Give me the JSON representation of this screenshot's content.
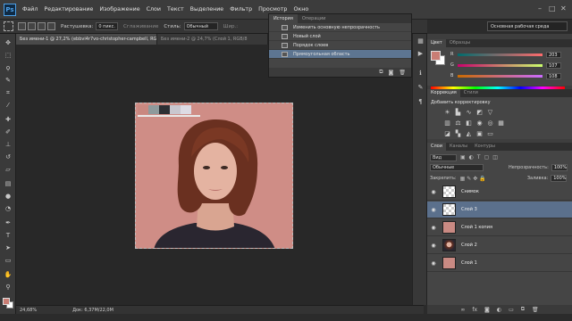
{
  "app": {
    "logo": "Ps"
  },
  "menu": [
    "Файл",
    "Редактирование",
    "Изображение",
    "Слои",
    "Текст",
    "Выделение",
    "Фильтр",
    "Просмотр",
    "Окно"
  ],
  "options": {
    "feather_label": "Растушевка:",
    "feather_value": "0 пикс.",
    "antialias_label": "Сглаживание",
    "style_label": "Стиль:",
    "style_value": "Обычный",
    "width_label": "Шир.:",
    "workspace": "Основная рабочая среда"
  },
  "doc_tabs": [
    {
      "label": "Без имени-1 @ 27,2% (ebbvi4r7vo-christopher-campbell, RGB/8",
      "active": true
    },
    {
      "label": "Без имени-2 @ 24,7% (Слой 1, RGB/8",
      "active": false
    }
  ],
  "palette_colors": [
    "#c98880",
    "#8e9a9c",
    "#2c2f34",
    "#c9c7cf",
    "#dddbe4"
  ],
  "status": {
    "zoom": "24,68%",
    "doc_size": "Док: 6,37М/22,0М"
  },
  "history": {
    "tabs": [
      "История",
      "Операции"
    ],
    "items": [
      {
        "label": "Изменить основную непрозрачность",
        "selected": false
      },
      {
        "label": "Новый слой",
        "selected": false
      },
      {
        "label": "Порядок слоев",
        "selected": false
      },
      {
        "label": "Прямоугольная область",
        "selected": true
      }
    ],
    "footer_icons": [
      "snapshot-icon",
      "camera-icon",
      "trash-icon"
    ]
  },
  "color_panel": {
    "tabs": [
      "Цвет",
      "Образцы"
    ],
    "fg": "#c97d74",
    "bg": "#ffffff",
    "r": {
      "label": "R",
      "value": "203"
    },
    "g": {
      "label": "G",
      "value": "107"
    },
    "b": {
      "label": "B",
      "value": "108"
    }
  },
  "corrections": {
    "tabs": [
      "Коррекция",
      "Стили"
    ],
    "title": "Добавить корректировку"
  },
  "layers_panel": {
    "tabs": [
      "Слои",
      "Каналы",
      "Контуры"
    ],
    "kind": "Вид",
    "blend": "Обычные",
    "opacity_label": "Непрозрачность:",
    "opacity_value": "100%",
    "lock_label": "Закрепить:",
    "fill_label": "Заливка:",
    "fill_value": "100%",
    "layers": [
      {
        "name": "Снимок",
        "selected": false,
        "thumb": "transparent"
      },
      {
        "name": "Слой 3",
        "selected": true,
        "thumb": "transparent"
      },
      {
        "name": "Слой 1 копия",
        "selected": false,
        "thumb": "#c98a83"
      },
      {
        "name": "Слой 2",
        "selected": false,
        "thumb": "portrait"
      },
      {
        "name": "Слой 1",
        "selected": false,
        "thumb": "#c98a83"
      }
    ]
  }
}
